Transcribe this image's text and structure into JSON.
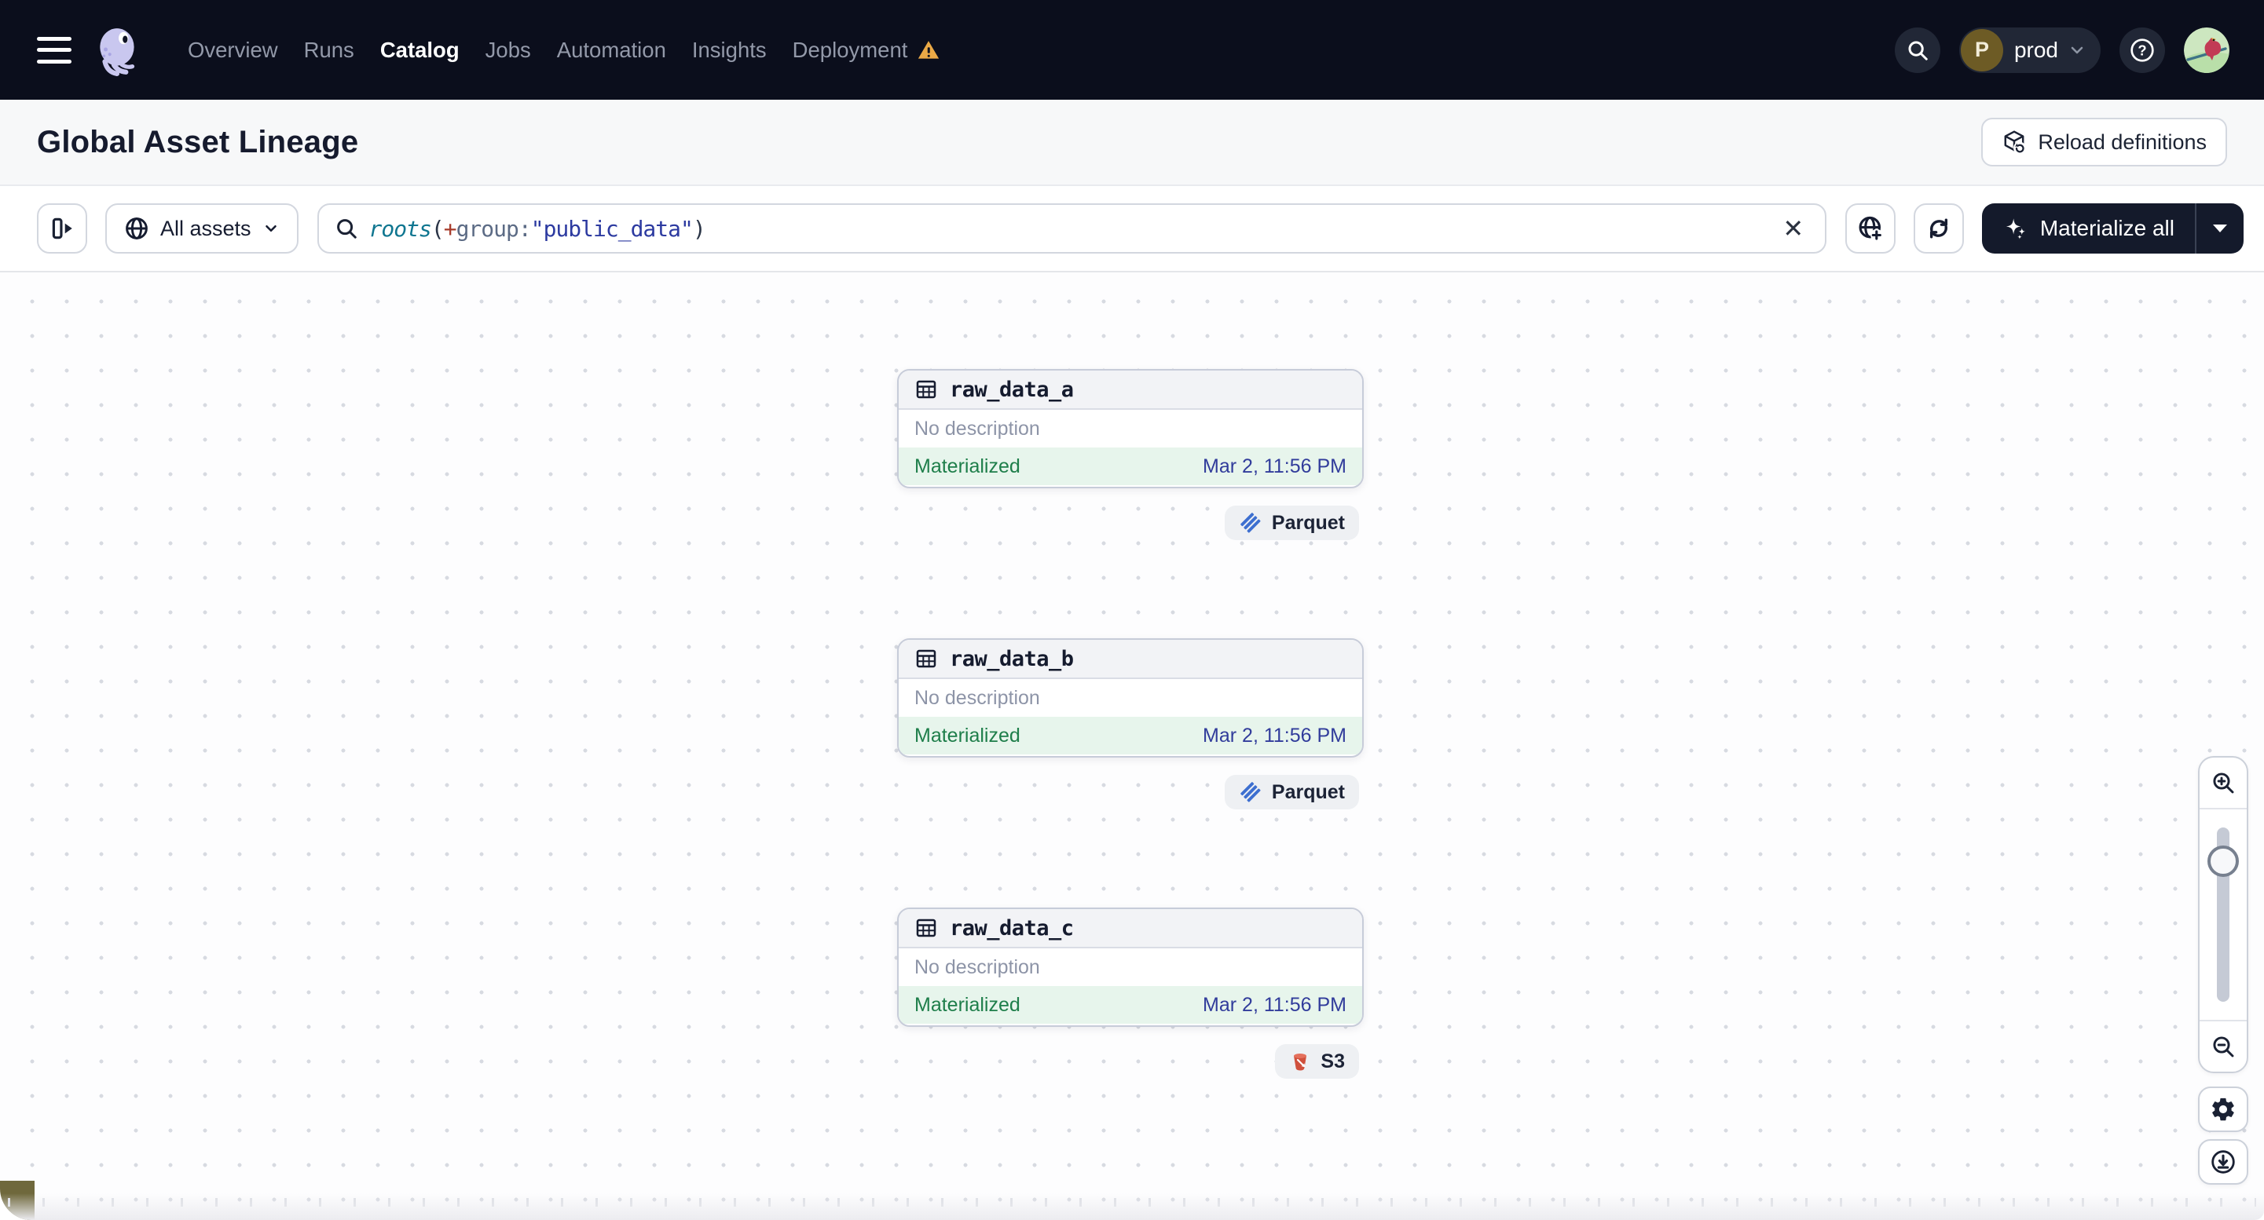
{
  "nav": {
    "items": [
      {
        "label": "Overview"
      },
      {
        "label": "Runs"
      },
      {
        "label": "Catalog"
      },
      {
        "label": "Jobs"
      },
      {
        "label": "Automation"
      },
      {
        "label": "Insights"
      },
      {
        "label": "Deployment"
      }
    ],
    "environment": {
      "initial": "P",
      "name": "prod"
    }
  },
  "header": {
    "title": "Global Asset Lineage",
    "reload_button": "Reload definitions"
  },
  "toolbar": {
    "filter_label": "All assets",
    "search": {
      "segments": [
        {
          "text": "roots",
          "type": "function"
        },
        {
          "text": "(",
          "type": "paren"
        },
        {
          "text": "+",
          "type": "plus"
        },
        {
          "text": "group:",
          "type": "attribute"
        },
        {
          "text": "\"public_data\"",
          "type": "value"
        },
        {
          "text": ")",
          "type": "paren"
        }
      ]
    },
    "clear_label": "✕",
    "materialize_label": "Materialize all"
  },
  "canvas": {
    "nodes": [
      {
        "name": "raw_data_a",
        "description": "No description",
        "status": "Materialized",
        "timestamp": "Mar 2, 11:56 PM",
        "tag": "Parquet",
        "tag_icon": "parquet-icon"
      },
      {
        "name": "raw_data_b",
        "description": "No description",
        "status": "Materialized",
        "timestamp": "Mar 2, 11:56 PM",
        "tag": "Parquet",
        "tag_icon": "parquet-icon"
      },
      {
        "name": "raw_data_c",
        "description": "No description",
        "status": "Materialized",
        "timestamp": "Mar 2, 11:56 PM",
        "tag": "S3",
        "tag_icon": "s3-icon"
      }
    ]
  },
  "colors": {
    "navbar_bg": "#0b0e1c",
    "status_green": "#1e7e4a",
    "timestamp_blue": "#313c9b",
    "warning_orange": "#eba946",
    "parquet_blue": "#3d6fd0",
    "s3_red": "#d0503c",
    "materialized_bg": "#e7f5ec"
  }
}
